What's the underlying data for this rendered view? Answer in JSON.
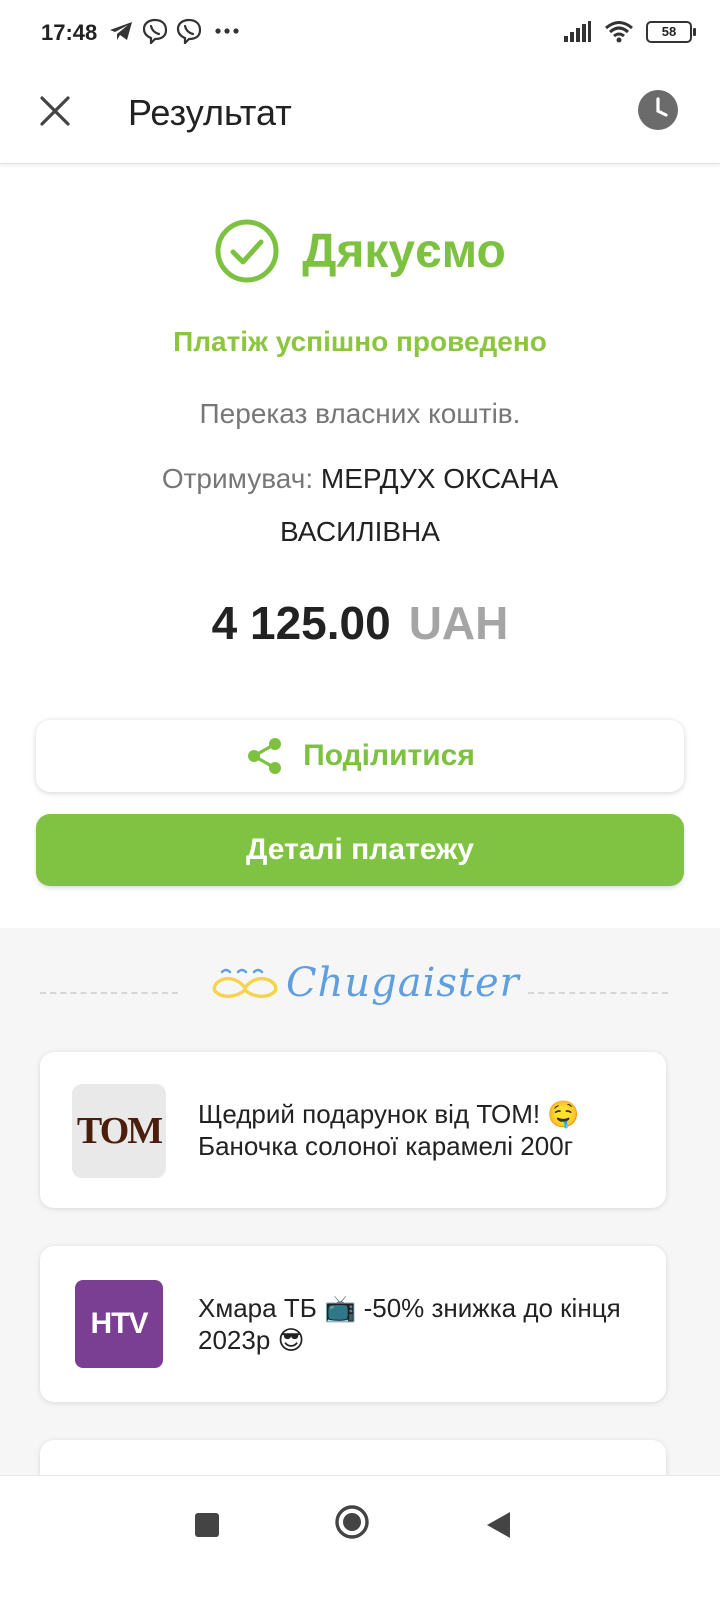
{
  "status_bar": {
    "time": "17:48",
    "battery": "58",
    "icons": [
      "telegram-icon",
      "viber-icon",
      "viber-icon",
      "more-icon",
      "signal-icon",
      "wifi-icon",
      "battery-icon"
    ]
  },
  "header": {
    "title": "Результат",
    "close_icon": "close-icon",
    "history_icon": "clock-icon"
  },
  "result": {
    "thanks": "Дякуємо",
    "success": "Платіж успішно проведено",
    "description": "Переказ власних коштів.",
    "recipient_label": "Отримувач:",
    "recipient_name": "МЕРДУХ ОКСАНА ВАСИЛІВНА",
    "amount": "4 125.00",
    "currency": "UAH"
  },
  "actions": {
    "share_label": "Поділитися",
    "details_label": "Деталі платежу"
  },
  "promo": {
    "brand": "Chugaister",
    "cards": [
      {
        "logo": "ТОМ",
        "text": "Щедрий подарунок від ТОМ! 🤤 Баночка солоної карамелі 200г"
      },
      {
        "logo": "HTV",
        "text": "Хмара ТБ 📺 -50% знижка до кінця 2023р 😎"
      }
    ]
  },
  "colors": {
    "accent_green": "#7dc141",
    "button_green": "#80c342",
    "brand_blue": "#5f9fe0",
    "logo_yellow": "#f5d34c",
    "htv_purple": "#7a3e93"
  }
}
